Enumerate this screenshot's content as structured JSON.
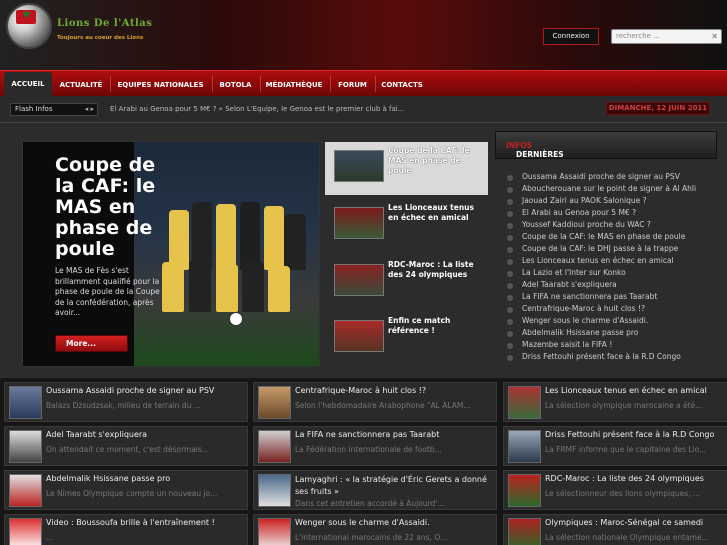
{
  "header": {
    "logo_title": "Lions De l'Atlas",
    "logo_tagline": "Toujours au coeur des Lions",
    "login_label": "Connexion",
    "search_placeholder": "recherche ..."
  },
  "nav": {
    "items": [
      "ACCUEIL",
      "ACTUALITÉ",
      "EQUIPES NATIONALES",
      "BOTOLA",
      "MÉDIATHÈQUE",
      "FORUM",
      "CONTACTS"
    ]
  },
  "flash": {
    "label": "Flash Infos",
    "arrows": "◂ ▸",
    "text": "El Arabi au Genoa pour 5 M€ ? » Selon L'Équipe, le Genoa est le premier club à fai...",
    "date": "DIMANCHE, 12 JUIN 2011"
  },
  "featured": {
    "title": "Coupe de la CAF: le MAS en phase de poule",
    "description": "Le MAS de Fès s'est brillamment qualifié pour la phase de poule de la Coupe de la confédération, après avoir...",
    "more_label": "More..."
  },
  "featured_list": [
    {
      "title": "Coupe de la CAF: le MAS en phase de poule"
    },
    {
      "title": "Les Lionceaux tenus en échec en amical"
    },
    {
      "title": "RDC-Maroc : La liste des 24 olympiques"
    },
    {
      "title": "Enfin ce match référence !"
    }
  ],
  "latest": {
    "heading": "DERNIÈRES",
    "heading_accent": "INFOS",
    "items": [
      "Oussama Assaidi proche de signer au PSV",
      "Aboucherouane sur le point de signer à Al Ahli",
      "Jaouad Zairi au PAOK Salonique ?",
      "El Arabi au Genoa pour 5 M€ ?",
      "Youssef Kaddioui proche du WAC ?",
      "Coupe de la CAF: le MAS en phase de poule",
      "Coupe de la CAF: le DHJ passe à la trappe",
      "Les Lionceaux tenus en échec en amical",
      "La Lazio et l'Inter sur Konko",
      "Adel Taarabt s'expliquera",
      "La FIFA ne sanctionnera pas Taarabt",
      "Centrafrique-Maroc à huit clos !?",
      "Wenger sous le charme d'Assaidi.",
      "Abdelmalik Hsissane passe pro",
      "Mazembe saisit la FIFA !",
      "Driss Fettouhi présent face à la R.D Congo"
    ]
  },
  "grid": [
    {
      "title": "Oussama Assaidi proche de signer au PSV",
      "desc": "Balazs Dzsudzsak, milieu de terrain du ..."
    },
    {
      "title": "Centrafrique-Maroc à huit clos !?",
      "desc": "Selon l'hebdomadaire Arabophone \"AL ALAM..."
    },
    {
      "title": "Les Lionceaux tenus en échec en amical",
      "desc": "La sélection olympique marocaine a été..."
    },
    {
      "title": "Adel Taarabt s'expliquera",
      "desc": "On attendait ce moment, c'est désormais..."
    },
    {
      "title": "La FIFA ne sanctionnera pas Taarabt",
      "desc": "La Fédération internationale de footb..."
    },
    {
      "title": "Driss Fettouhi présent face à la R.D Congo",
      "desc": "La FRMF informe que le capitaine des Lio..."
    },
    {
      "title": "Abdelmalik Hsissane passe pro",
      "desc": "Le Nîmes Olympique compte un nouveau jo..."
    },
    {
      "title": "Lamyaghri : « la stratégie d'Éric Gerets a donné ses fruits »",
      "desc": "Dans cet entretien accordé à Aujourd'..."
    },
    {
      "title": "RDC-Maroc : La liste des 24 olympiques",
      "desc": "Le sélectionneur des lions olympiques, ..."
    },
    {
      "title": "Video : Boussoufa brille à l'entraînement !",
      "desc": "..."
    },
    {
      "title": "Wenger sous le charme d'Assaidi.",
      "desc": "L'international marocains de 22 ans, O..."
    },
    {
      "title": "Olympiques : Maroc-Sénégal ce samedi",
      "desc": "La sélection nationale Olympique entame..."
    }
  ],
  "colors": {
    "accent_red": "#b00d0d",
    "nav_active_bg": "#2a2a2a",
    "logo_green": "#6fae2e"
  }
}
